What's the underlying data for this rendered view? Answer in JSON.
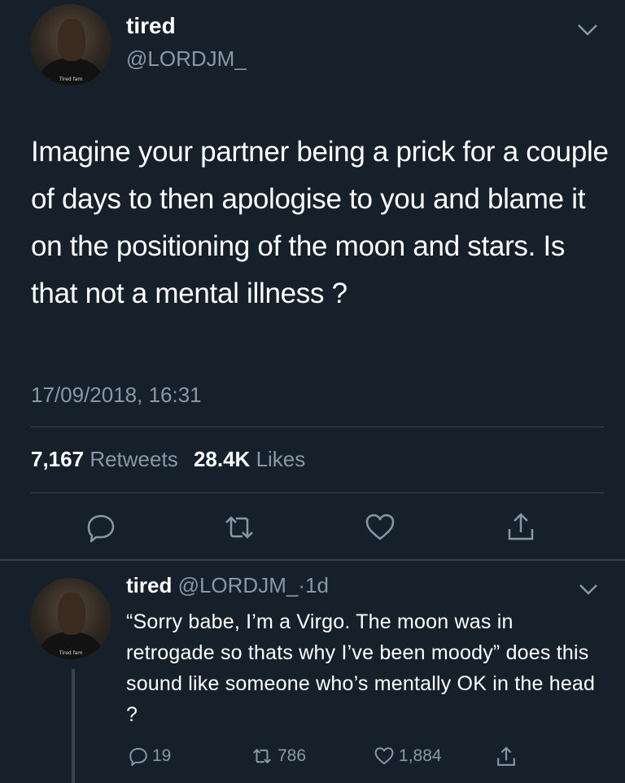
{
  "tweet": {
    "author_name": "tired",
    "author_handle": "@LORDJM_",
    "avatar_caption": "Tired fam",
    "text": "Imagine your partner being a prick for a couple of days to then apologise to you and blame it on the positioning of the moon and stars. Is that not a mental illness ?",
    "timestamp": "17/09/2018, 16:31",
    "retweet_count": "7,167",
    "retweet_label": "Retweets",
    "like_count": "28.4K",
    "like_label": "Likes"
  },
  "reply": {
    "author_name": "tired",
    "author_handle": "@LORDJM_",
    "separator": "·",
    "age": "1d",
    "avatar_caption": "Tired fam",
    "text": "“Sorry babe, I’m a Virgo. The moon was in retrogade so thats why I’ve been moody” does this sound like someone who’s mentally OK in the head ?",
    "reply_count": "19",
    "retweet_count": "786",
    "like_count": "1,884"
  },
  "colors": {
    "background": "#15202b",
    "text": "#ffffff",
    "muted": "#8899a6",
    "divider": "#38444d"
  },
  "icons": [
    "chevron-down-icon",
    "reply-icon",
    "retweet-icon",
    "like-icon",
    "share-icon"
  ]
}
